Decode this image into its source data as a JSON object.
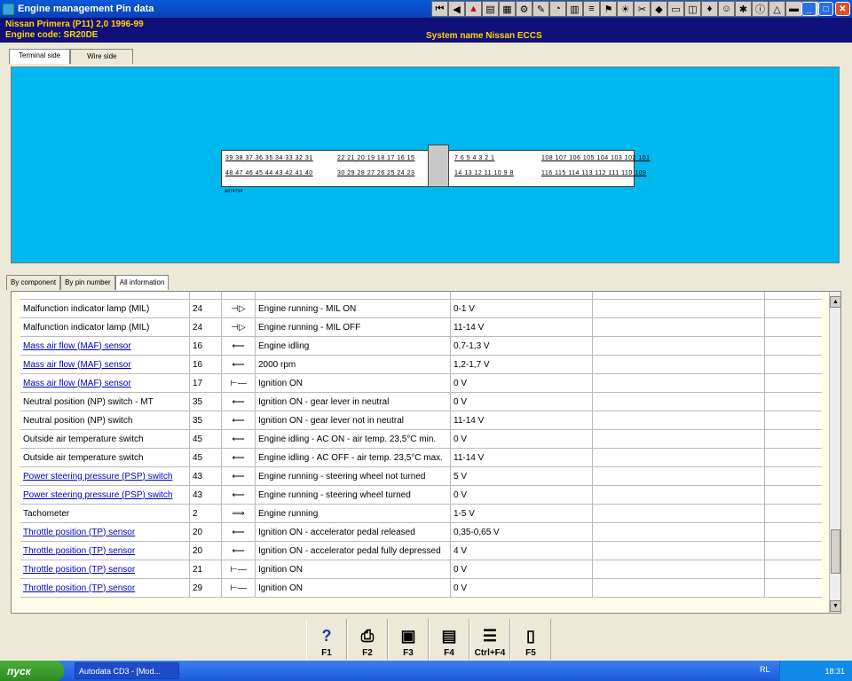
{
  "window": {
    "title": "Engine management Pin data"
  },
  "info": {
    "model": "Nissan  Primera (P11) 2,0  1996-99",
    "engine": "Engine code: SR20DE",
    "system": "System name Nissan ECCS"
  },
  "view_tabs": [
    "Terminal side",
    "Wire side"
  ],
  "connector": {
    "row1_left": "39 38 37 36 35 34 33 32 31",
    "row1_mid": "22 21 20 19 18 17 16 15",
    "row1_right": "7  6  5  4  3  2  1",
    "row1_far": "108 107 106 105 104 103 102 101",
    "row2_left": "48 47 46 45 44 43 42 41 40",
    "row2_mid": "30 29 28 27 26 25 24 23",
    "row2_right": "14 13 12 11 10  9  8",
    "row2_far": "116 115 114 113 112 111 110 109",
    "code": "A074704"
  },
  "list_tabs": [
    "By component",
    "By pin number",
    "All information"
  ],
  "rows": [
    {
      "component": "Malfunction indicator lamp (MIL)",
      "pin": "24",
      "icon": "output-lamp",
      "cond": "Engine running - MIL ON",
      "value": "0-1 V",
      "link": false
    },
    {
      "component": "Malfunction indicator lamp (MIL)",
      "pin": "24",
      "icon": "output-lamp",
      "cond": "Engine running - MIL OFF",
      "value": "11-14 V",
      "link": false
    },
    {
      "component": "Mass air flow (MAF) sensor",
      "pin": "16",
      "icon": "input-arrow",
      "cond": "Engine idling",
      "value": "0,7-1,3 V",
      "link": true
    },
    {
      "component": "Mass air flow (MAF) sensor",
      "pin": "16",
      "icon": "input-arrow",
      "cond": "2000 rpm",
      "value": "1,2-1,7 V",
      "link": true
    },
    {
      "component": "Mass air flow (MAF) sensor",
      "pin": "17",
      "icon": "ground",
      "cond": "Ignition ON",
      "value": "0 V",
      "link": true
    },
    {
      "component": "Neutral position (NP) switch - MT",
      "pin": "35",
      "icon": "input-arrow",
      "cond": "Ignition ON - gear lever in neutral",
      "value": "0 V",
      "link": false
    },
    {
      "component": "Neutral position (NP) switch",
      "pin": "35",
      "icon": "input-arrow",
      "cond": "Ignition ON - gear lever not in neutral",
      "value": "11-14 V",
      "link": false
    },
    {
      "component": "Outside air temperature switch",
      "pin": "45",
      "icon": "input-arrow",
      "cond": "Engine idling - AC ON - air temp. 23,5°C min.",
      "value": "0 V",
      "link": false
    },
    {
      "component": "Outside air temperature switch",
      "pin": "45",
      "icon": "input-arrow",
      "cond": "Engine idling - AC OFF - air temp. 23,5°C max.",
      "value": "11-14 V",
      "link": false
    },
    {
      "component": "Power steering pressure (PSP) switch",
      "pin": "43",
      "icon": "input-arrow",
      "cond": "Engine running - steering wheel not turned",
      "value": "5 V",
      "link": true
    },
    {
      "component": "Power steering pressure (PSP) switch",
      "pin": "43",
      "icon": "input-arrow",
      "cond": "Engine running - steering wheel turned",
      "value": "0 V",
      "link": true
    },
    {
      "component": "Tachometer",
      "pin": "2",
      "icon": "output-arrow",
      "cond": "Engine running",
      "value": "1-5 V",
      "link": false
    },
    {
      "component": "Throttle position (TP) sensor",
      "pin": "20",
      "icon": "input-arrow",
      "cond": "Ignition ON - accelerator pedal released",
      "value": "0,35-0,65 V",
      "link": true
    },
    {
      "component": "Throttle position (TP) sensor",
      "pin": "20",
      "icon": "input-arrow",
      "cond": "Ignition ON - accelerator pedal fully depressed",
      "value": "4 V",
      "link": true
    },
    {
      "component": "Throttle position (TP) sensor",
      "pin": "21",
      "icon": "ground",
      "cond": "Ignition ON",
      "value": "0 V",
      "link": true
    },
    {
      "component": "Throttle position (TP) sensor",
      "pin": "29",
      "icon": "ground",
      "cond": "Ignition ON",
      "value": "0 V",
      "link": true
    }
  ],
  "fkeys": [
    {
      "label": "F1",
      "icon": "help-icon"
    },
    {
      "label": "F2",
      "icon": "print-icon"
    },
    {
      "label": "F3",
      "icon": "window-icon"
    },
    {
      "label": "F4",
      "icon": "window-plus-icon"
    },
    {
      "label": "Ctrl+F4",
      "icon": "list-icon"
    },
    {
      "label": "F5",
      "icon": "book-icon"
    }
  ],
  "taskbar": {
    "start": "пуск",
    "task": "Autodata CD3 - [Mod...",
    "lang": "RL",
    "time": "18:31"
  }
}
